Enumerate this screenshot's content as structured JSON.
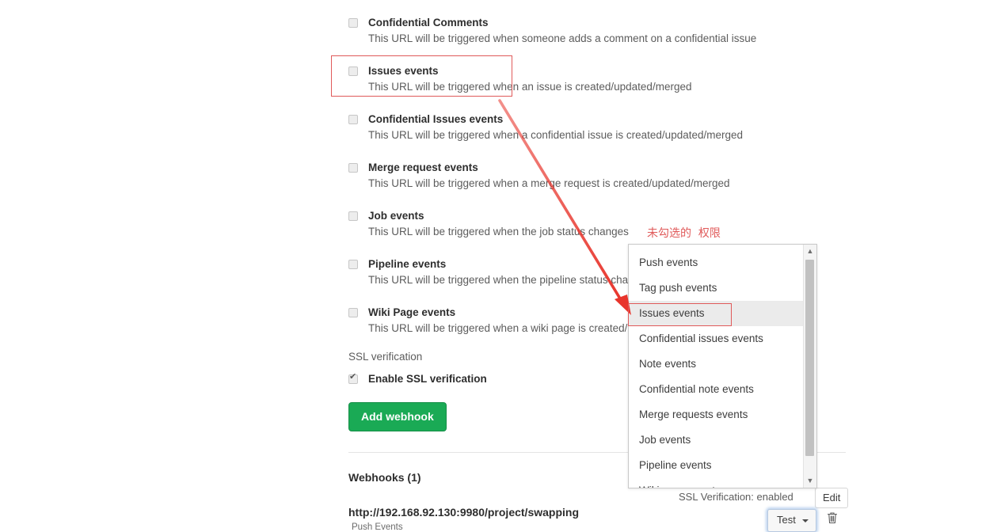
{
  "settings": {
    "events": [
      {
        "id": "confidential-comments",
        "title": "Confidential Comments",
        "desc": "This URL will be triggered when someone adds a comment on a confidential issue",
        "checked": false
      },
      {
        "id": "issues-events",
        "title": "Issues events",
        "desc": "This URL will be triggered when an issue is created/updated/merged",
        "checked": false
      },
      {
        "id": "confidential-issues-events",
        "title": "Confidential Issues events",
        "desc": "This URL will be triggered when a confidential issue is created/updated/merged",
        "checked": false
      },
      {
        "id": "merge-request-events",
        "title": "Merge request events",
        "desc": "This URL will be triggered when a merge request is created/updated/merged",
        "checked": false
      },
      {
        "id": "job-events",
        "title": "Job events",
        "desc": "This URL will be triggered when the job status changes",
        "checked": false
      },
      {
        "id": "pipeline-events",
        "title": "Pipeline events",
        "desc": "This URL will be triggered when the pipeline status changes",
        "checked": false
      },
      {
        "id": "wiki-page-events",
        "title": "Wiki Page events",
        "desc": "This URL will be triggered when a wiki page is created/updated",
        "checked": false
      }
    ],
    "ssl_section_label": "SSL verification",
    "enable_ssl_label": "Enable SSL verification",
    "enable_ssl_checked": true,
    "add_webhook_label": "Add webhook"
  },
  "webhooks": {
    "heading": "Webhooks (1)",
    "url": "http://192.168.92.130:9980/project/swapping",
    "events_label": "Push Events",
    "ssl_status": "SSL Verification: enabled",
    "edit_label": "Edit",
    "test_label": "Test",
    "delete_icon": "trash-icon"
  },
  "dropdown": {
    "items": [
      "Push events",
      "Tag push events",
      "Issues events",
      "Confidential issues events",
      "Note events",
      "Confidential note events",
      "Merge requests events",
      "Job events",
      "Pipeline events",
      "Wiki page events"
    ],
    "selected": "Issues events",
    "scroll_up_icon": "▲",
    "scroll_down_icon": "▼"
  },
  "annotations": {
    "chinese_note": "未勾选的  权限",
    "accent_color": "#e05a5a",
    "arrow_color": "#e8352c"
  }
}
